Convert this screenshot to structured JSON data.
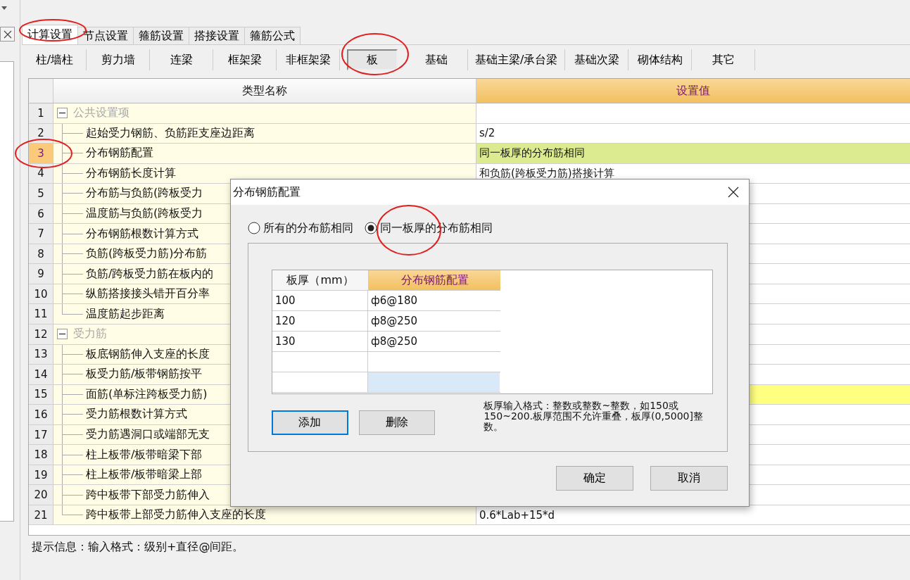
{
  "tabs": [
    {
      "label": "计算设置",
      "selected": true
    },
    {
      "label": "节点设置",
      "selected": false
    },
    {
      "label": "箍筋设置",
      "selected": false
    },
    {
      "label": "搭接设置",
      "selected": false
    },
    {
      "label": "箍筋公式",
      "selected": false
    }
  ],
  "subtabs": [
    {
      "label": "柱/墙柱",
      "selected": false
    },
    {
      "label": "剪力墙",
      "selected": false
    },
    {
      "label": "连梁",
      "selected": false
    },
    {
      "label": "框架梁",
      "selected": false
    },
    {
      "label": "非框架梁",
      "selected": false
    },
    {
      "label": "板",
      "selected": true
    },
    {
      "label": "基础",
      "selected": false
    },
    {
      "label": "基础主梁/承台梁",
      "selected": false
    },
    {
      "label": "基础次梁",
      "selected": false
    },
    {
      "label": "砌体结构",
      "selected": false
    },
    {
      "label": "其它",
      "selected": false
    }
  ],
  "grid": {
    "columns": [
      "类型名称",
      "设置值"
    ],
    "groups": [
      {
        "num": "1",
        "name": "公共设置项",
        "expanded": true,
        "selected": false,
        "children": [
          {
            "num": "2",
            "name": "起始受力钢筋、负筋距支座边距离",
            "value": "s/2",
            "selected": false
          },
          {
            "num": "3",
            "name": "分布钢筋配置",
            "value": "同一板厚的分布筋相同",
            "selected": true,
            "color": "#dcea90"
          },
          {
            "num": "4",
            "name": "分布钢筋长度计算",
            "value": "和负筋(跨板受力筋)搭接计算",
            "selected": false
          },
          {
            "num": "5",
            "name": "分布筋与负筋(跨板受力",
            "selected": false
          },
          {
            "num": "6",
            "name": "温度筋与负筋(跨板受力",
            "selected": false
          },
          {
            "num": "7",
            "name": "分布钢筋根数计算方式",
            "selected": false
          },
          {
            "num": "8",
            "name": "负筋(跨板受力筋)分布筋",
            "selected": false
          },
          {
            "num": "9",
            "name": "负筋/跨板受力筋在板内的",
            "selected": false
          },
          {
            "num": "10",
            "name": "纵筋搭接接头错开百分率",
            "selected": false
          },
          {
            "num": "11",
            "name": "温度筋起步距离",
            "selected": false
          }
        ]
      },
      {
        "num": "12",
        "name": "受力筋",
        "expanded": true,
        "selected": false,
        "children": [
          {
            "num": "13",
            "name": "板底钢筋伸入支座的长度",
            "selected": false
          },
          {
            "num": "14",
            "name": "板受力筋/板带钢筋按平",
            "selected": false
          },
          {
            "num": "15",
            "name": "面筋(单标注跨板受力筋)",
            "selected": false,
            "color": "#ffff80"
          },
          {
            "num": "16",
            "name": "受力筋根数计算方式",
            "selected": false
          },
          {
            "num": "17",
            "name": "受力筋遇洞口或端部无支",
            "selected": false
          },
          {
            "num": "18",
            "name": "柱上板带/板带暗梁下部",
            "selected": false
          },
          {
            "num": "19",
            "name": "柱上板带/板带暗梁上部",
            "selected": false
          },
          {
            "num": "20",
            "name": "跨中板带下部受力筋伸入",
            "selected": false
          },
          {
            "num": "21",
            "name": "跨中板带上部受力筋伸入支座的长度",
            "value": "0.6*Lab+15*d",
            "selected": false
          }
        ]
      }
    ]
  },
  "dialog": {
    "title": "分布钢筋配置",
    "options": [
      {
        "label": "所有的分布筋相同",
        "selected": false
      },
      {
        "label": "同一板厚的分布筋相同",
        "selected": true
      }
    ],
    "table": {
      "columns": [
        "板厚（mm）",
        "分布钢筋配置"
      ],
      "rows": [
        {
          "thickness": "100",
          "config": "ф6@180",
          "selected": false
        },
        {
          "thickness": "120",
          "config": "ф8@250",
          "selected": false
        },
        {
          "thickness": "130",
          "config": "ф8@250",
          "selected": false
        },
        {
          "selected": false
        },
        {
          "selected": true
        }
      ]
    },
    "buttons": [
      {
        "label": "添加",
        "focused": true
      },
      {
        "label": "删除",
        "focused": false
      }
    ],
    "note": "板厚输入格式：整数或整数~整数，如150或150~200.板厚范围不允许重叠，板厚(0,5000]整数。",
    "footer_buttons": [
      "确定",
      "取消"
    ]
  },
  "status_bar": "提示信息：输入格式：级别+直径@间距。"
}
